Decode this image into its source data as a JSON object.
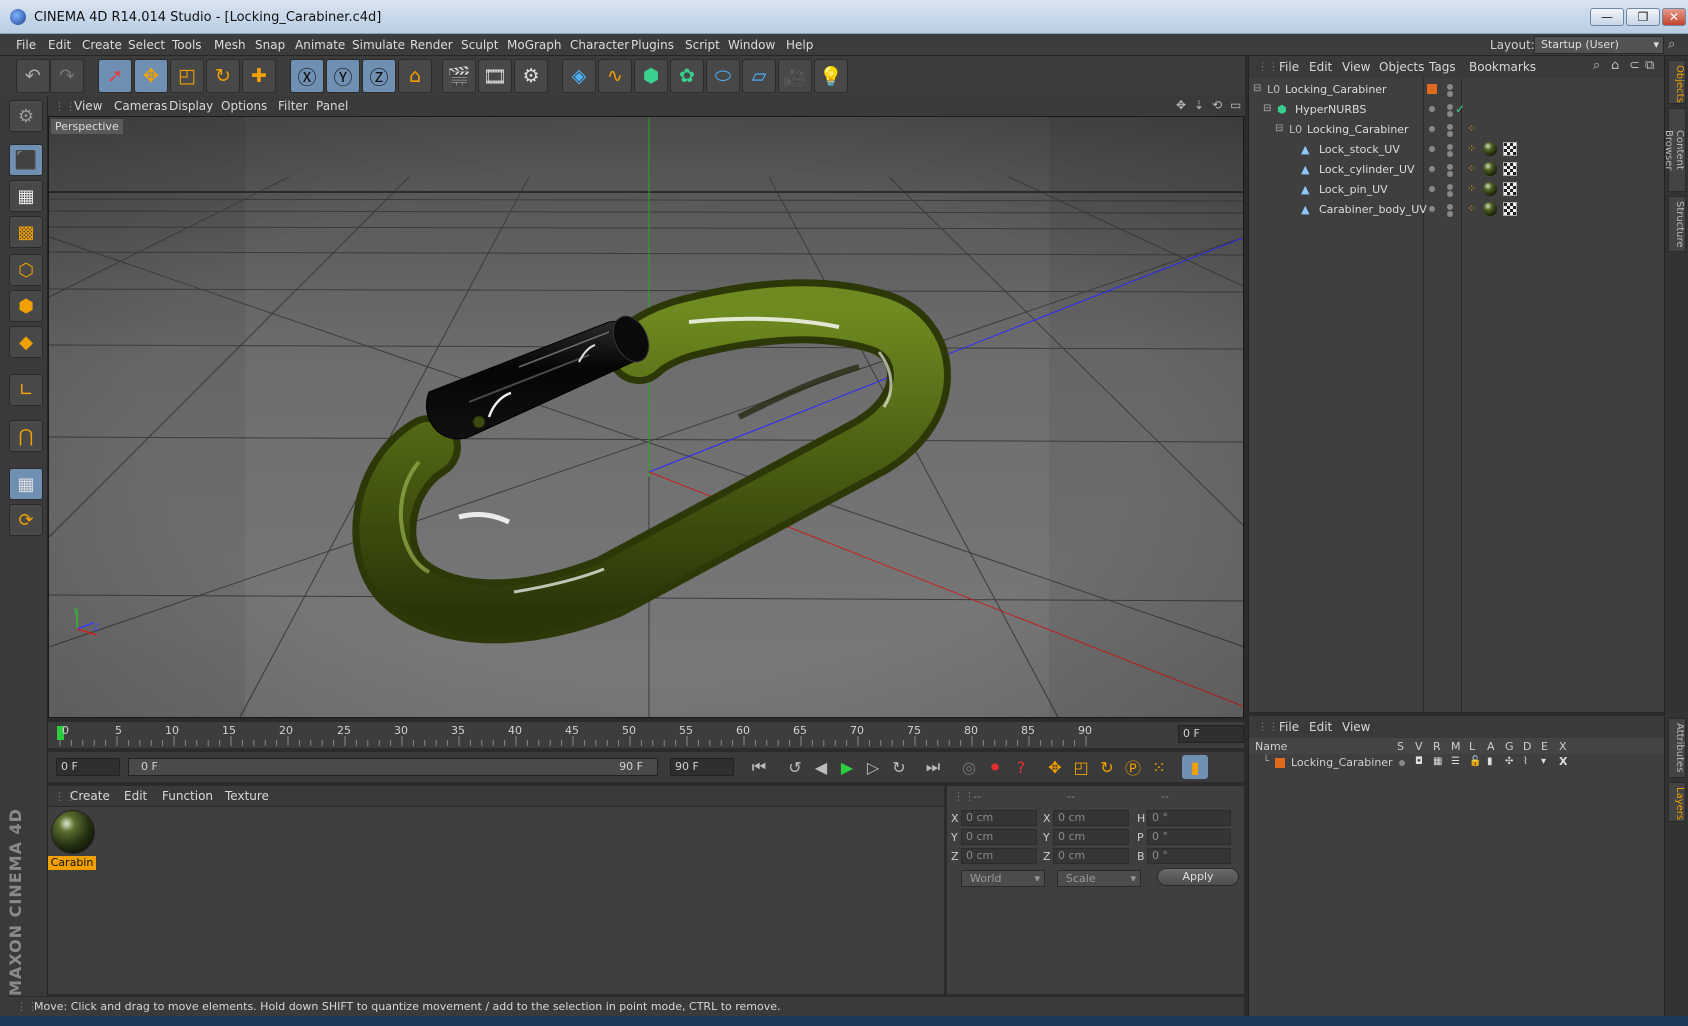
{
  "window": {
    "title": "CINEMA 4D R14.014 Studio - [Locking_Carabiner.c4d]",
    "minimize": "—",
    "restore": "❐",
    "close": "✕"
  },
  "menu": [
    "File",
    "Edit",
    "Create",
    "Select",
    "Tools",
    "Mesh",
    "Snap",
    "Animate",
    "Simulate",
    "Render",
    "Sculpt",
    "MoGraph",
    "Character",
    "Plugins",
    "Script",
    "Window",
    "Help"
  ],
  "layout": {
    "label": "Layout:",
    "value": "Startup (User)"
  },
  "viewport": {
    "menu": [
      "View",
      "Cameras",
      "Display",
      "Options",
      "Filter",
      "Panel"
    ],
    "label": "Perspective",
    "axis_y": "Y",
    "axis_z": "Z"
  },
  "timeline": {
    "ticks": [
      "0",
      "5",
      "10",
      "15",
      "20",
      "25",
      "30",
      "35",
      "40",
      "45",
      "50",
      "55",
      "60",
      "65",
      "70",
      "75",
      "80",
      "85",
      "90"
    ],
    "current_frame": "0 F"
  },
  "transport": {
    "start": "0 F",
    "range_start": "0 F",
    "range_end": "90 F",
    "end": "90 F"
  },
  "materials": {
    "menu": [
      "Create",
      "Edit",
      "Function",
      "Texture"
    ],
    "items": [
      {
        "name": "Carabin"
      }
    ]
  },
  "coordinates": {
    "headers": [
      "--",
      "--",
      "--"
    ],
    "rows": [
      {
        "l1": "X",
        "v1": "0 cm",
        "l2": "X",
        "v2": "0 cm",
        "l3": "H",
        "v3": "0 °"
      },
      {
        "l1": "Y",
        "v1": "0 cm",
        "l2": "Y",
        "v2": "0 cm",
        "l3": "P",
        "v3": "0 °"
      },
      {
        "l1": "Z",
        "v1": "0 cm",
        "l2": "Z",
        "v2": "0 cm",
        "l3": "B",
        "v3": "0 °"
      }
    ],
    "mode_world": "World",
    "mode_scale": "Scale",
    "apply": "Apply"
  },
  "status": "Move: Click and drag to move elements. Hold down SHIFT to quantize movement / add to the selection in point mode, CTRL to remove.",
  "objects": {
    "menu": [
      "File",
      "Edit",
      "View",
      "Objects",
      "Tags",
      "Bookmarks"
    ],
    "tree": [
      {
        "name": "Locking_Carabiner",
        "depth": 0,
        "type": "null"
      },
      {
        "name": "HyperNURBS",
        "depth": 1,
        "type": "nurbs"
      },
      {
        "name": "Locking_Carabiner",
        "depth": 2,
        "type": "null"
      },
      {
        "name": "Lock_stock_UV",
        "depth": 3,
        "type": "poly"
      },
      {
        "name": "Lock_cylinder_UV",
        "depth": 3,
        "type": "poly"
      },
      {
        "name": "Lock_pin_UV",
        "depth": 3,
        "type": "poly"
      },
      {
        "name": "Carabiner_body_UV",
        "depth": 3,
        "type": "poly"
      }
    ]
  },
  "layers": {
    "menu": [
      "File",
      "Edit",
      "View"
    ],
    "columns": [
      "Name",
      "S",
      "V",
      "R",
      "M",
      "L",
      "A",
      "G",
      "D",
      "E",
      "X"
    ],
    "items": [
      {
        "name": "Locking_Carabiner"
      }
    ]
  },
  "side_tabs": [
    "Objects",
    "Content Browser",
    "Structure"
  ],
  "side_tabs_bottom": [
    "Attributes",
    "Layers"
  ],
  "brand": "MAXON CINEMA 4D",
  "colors": {
    "accent": "#f0a000",
    "selection": "#6f8fb3",
    "carabiner": "#4f6414",
    "lock": "#0c0c0c"
  }
}
